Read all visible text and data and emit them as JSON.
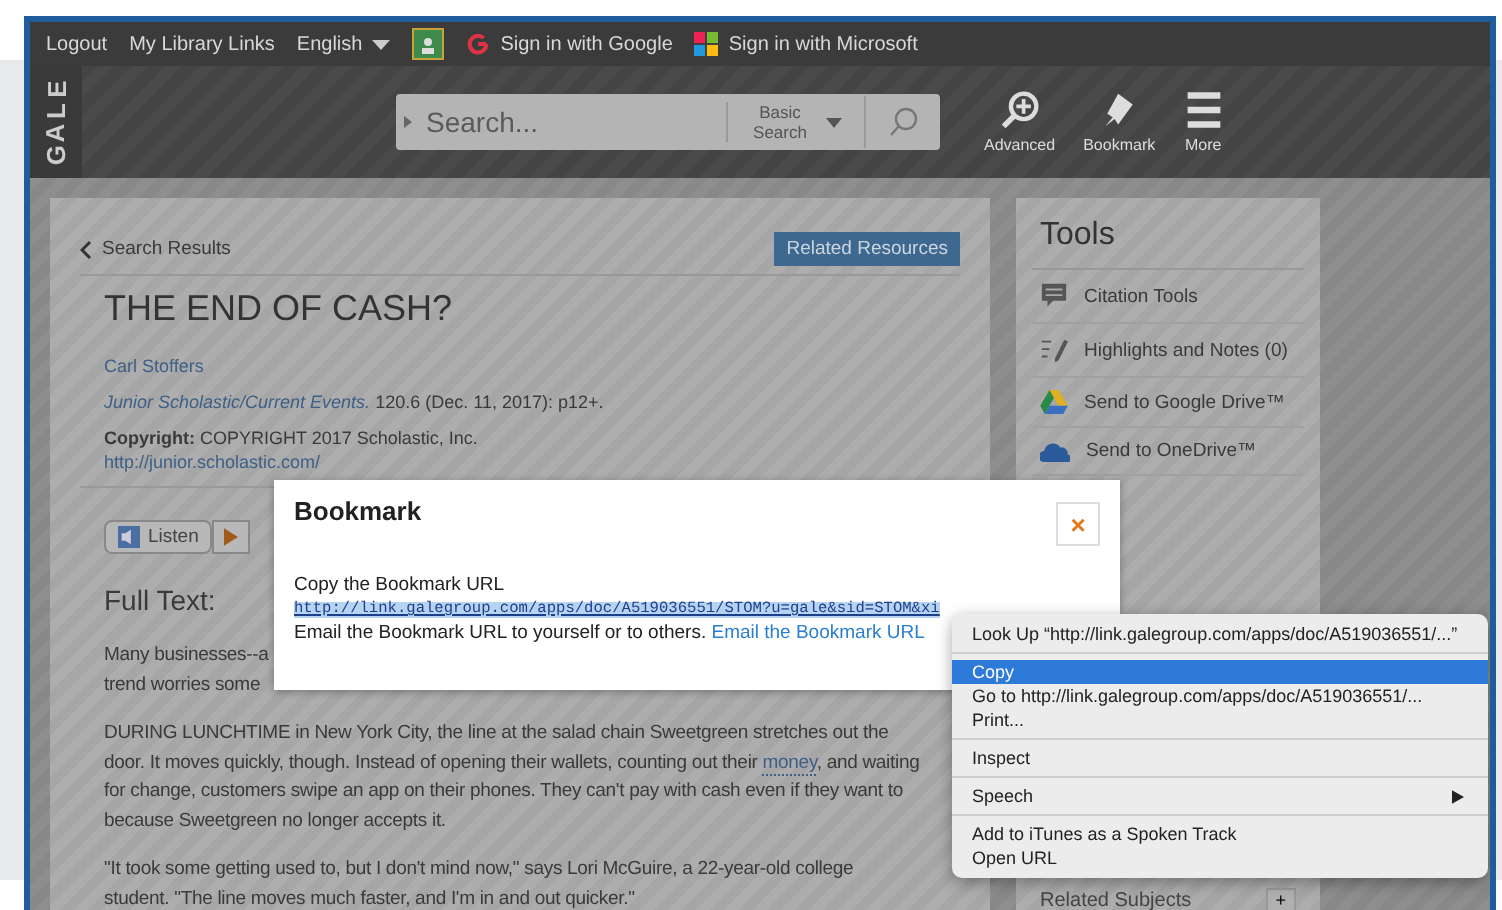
{
  "top_bar": {
    "links": [
      "Logout",
      "My Library Links"
    ],
    "language": "English",
    "sign_in": [
      "Sign in with Google",
      "Sign in with Microsoft"
    ]
  },
  "header": {
    "logo": "GALE",
    "search": {
      "placeholder": "Search...",
      "mode": "Basic Search"
    },
    "actions": [
      "Advanced",
      "Bookmark",
      "More"
    ]
  },
  "article": {
    "back": "Search Results",
    "related_button": "Related Resources",
    "title": "THE END OF CASH?",
    "author": "Carl Stoffers",
    "source_link": "Junior Scholastic/Current Events.",
    "source_rest": "120.6 (Dec. 11, 2017): p12+.",
    "copyright": "**Copyright:** COPYRIGHT 2017 Scholastic, Inc.",
    "publisher_url": "http://junior.scholastic.com/",
    "listen": "Listen",
    "full_text_heading": "Full Text:",
    "cut_lines": [
      "Many businesses--a",
      "trend worries some"
    ],
    "paragraphs": [
      [
        {
          "kind": "text",
          "text": "DURING LUNCHTIME in New York City, the line at the salad chain Sweetgreen stretches out the door. It moves quickly, though. Instead of opening their wallets, counting out their "
        },
        {
          "kind": "link",
          "text": "money"
        },
        {
          "kind": "text",
          "text": ", and waiting for change, customers swipe an app on their phones. They can't pay with cash even if they want to because Sweetgreen no longer accepts it."
        }
      ],
      [
        {
          "kind": "text",
          "text": "\"It took some getting used to, but I don't mind now,\" says Lori McGuire, a 22-year-old college student. \"The line moves much faster, and I'm in and out quicker.\""
        }
      ]
    ]
  },
  "tools": {
    "title": "Tools",
    "items": [
      "Citation Tools",
      "Highlights and Notes (0)",
      "Send to Google Drive™",
      "Send to OneDrive™"
    ],
    "related_subjects": "Related Subjects",
    "expand": "+"
  },
  "modal": {
    "title": "Bookmark",
    "close": "×",
    "copy_label": "Copy the Bookmark URL",
    "url": "http://link.galegroup.com/apps/doc/A519036551/STOM?u=gale&sid=STOM&xi",
    "email_text": "Email the Bookmark URL to yourself or to others.",
    "email_link": "Email the Bookmark URL"
  },
  "context_menu": [
    {
      "kind": "item",
      "label": "Look Up “http://link.galegroup.com/apps/doc/A519036551/...”",
      "selected": false
    },
    {
      "kind": "separator"
    },
    {
      "kind": "item",
      "label": "Copy",
      "selected": true
    },
    {
      "kind": "item",
      "label": "Go to http://link.galegroup.com/apps/doc/A519036551/...",
      "selected": false
    },
    {
      "kind": "item",
      "label": "Print...",
      "selected": false
    },
    {
      "kind": "separator"
    },
    {
      "kind": "item",
      "label": "Inspect",
      "selected": false
    },
    {
      "kind": "separator"
    },
    {
      "kind": "submenu",
      "label": "Speech",
      "selected": false
    },
    {
      "kind": "separator"
    },
    {
      "kind": "item",
      "label": "Add to iTunes as a Spoken Track",
      "selected": false
    },
    {
      "kind": "item",
      "label": "Open URL",
      "selected": false
    }
  ]
}
